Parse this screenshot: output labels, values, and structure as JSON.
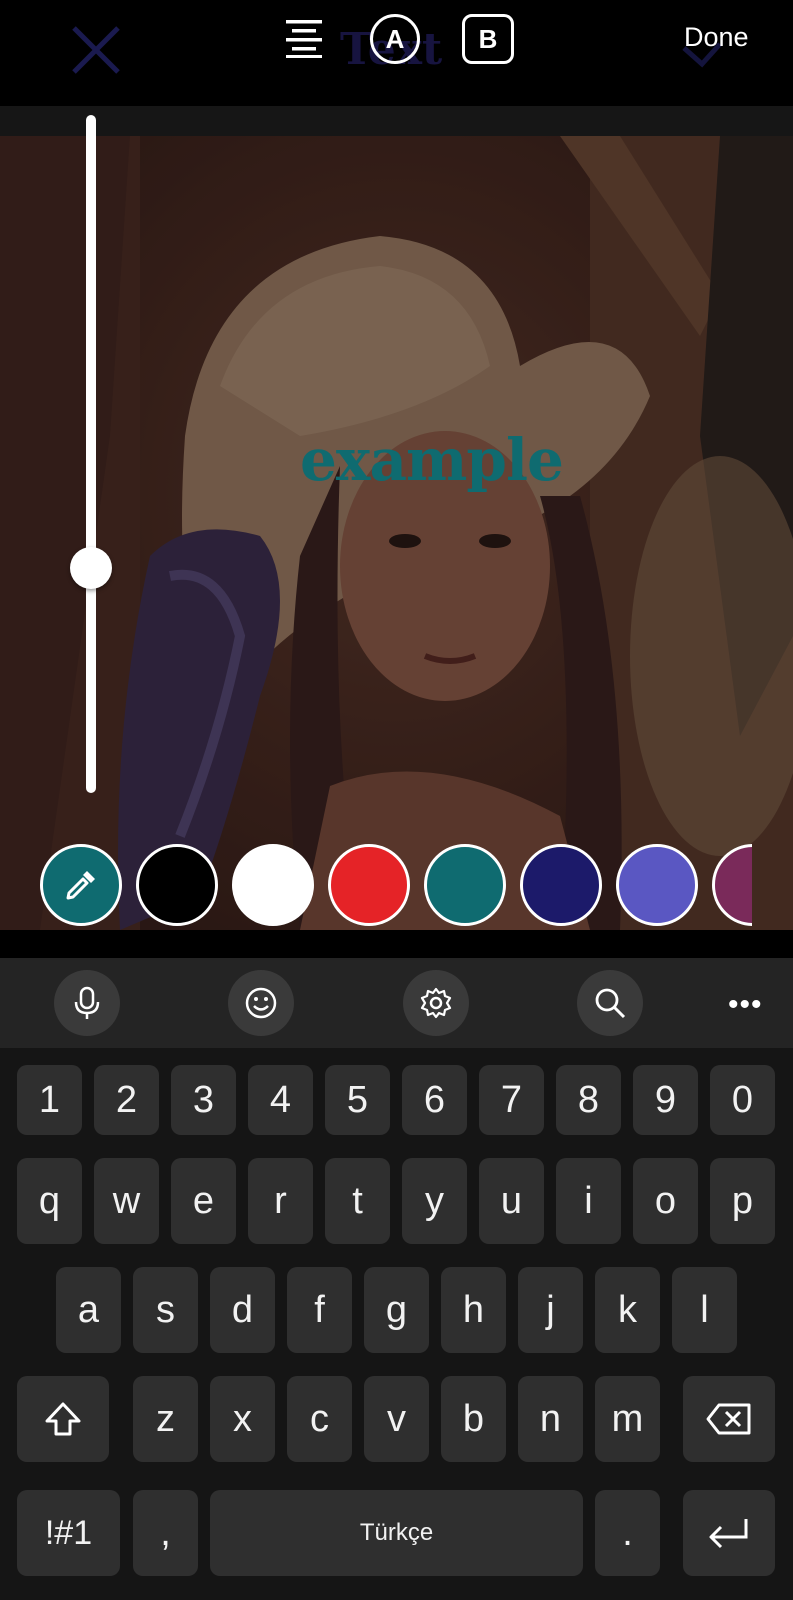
{
  "topbar": {
    "done_label": "Done",
    "font_a_label": "A",
    "font_b_label": "B",
    "ghost_text": "Text"
  },
  "canvas": {
    "text": "example",
    "text_color": "#0f6b70"
  },
  "slider": {
    "level": 0.34
  },
  "colors": [
    "picker",
    "#000000",
    "#ffffff",
    "#e52327",
    "#0f6b70",
    "#1c1a6a",
    "#5a57c2",
    "#7a2a5a"
  ],
  "keyboard": {
    "toolbar": [
      "microphone-icon",
      "emoji-icon",
      "settings-icon",
      "search-icon",
      "more-icon"
    ],
    "more_label": "•••",
    "row_numbers": [
      "1",
      "2",
      "3",
      "4",
      "5",
      "6",
      "7",
      "8",
      "9",
      "0"
    ],
    "row1": [
      "q",
      "w",
      "e",
      "r",
      "t",
      "y",
      "u",
      "i",
      "o",
      "p"
    ],
    "row2": [
      "a",
      "s",
      "d",
      "f",
      "g",
      "h",
      "j",
      "k",
      "l"
    ],
    "row3": [
      "z",
      "x",
      "c",
      "v",
      "b",
      "n",
      "m"
    ],
    "symbols_label": "!#1",
    "comma_label": ",",
    "space_label": "Türkçe",
    "period_label": "."
  }
}
